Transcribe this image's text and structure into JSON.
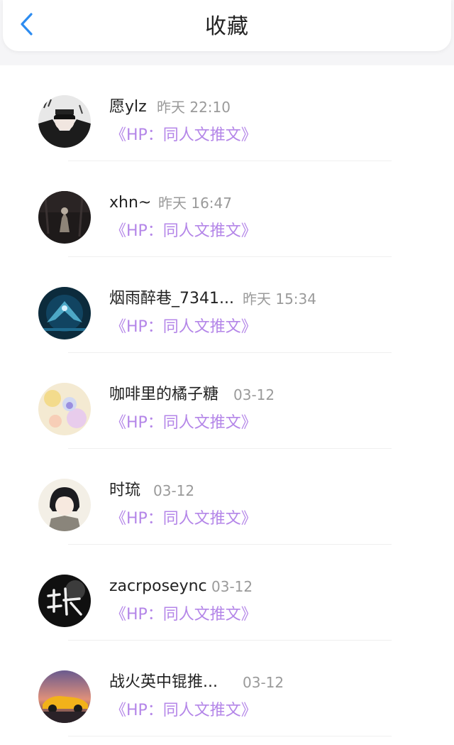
{
  "header": {
    "title": "收藏",
    "back_icon": "chevron-left-icon",
    "accent": "#2d8cf0"
  },
  "link_color": "#b486e8",
  "items": [
    {
      "name": "愿ylz",
      "time": "昨天 22:10",
      "book": "《HP：同人文推文》"
    },
    {
      "name": "xhn~",
      "time": "昨天 16:47",
      "book": "《HP：同人文推文》"
    },
    {
      "name": "烟雨醉巷_7341...",
      "time": "昨天 15:34",
      "book": "《HP：同人文推文》"
    },
    {
      "name": "咖啡里的橘子糖",
      "time": "03-12",
      "book": "《HP：同人文推文》"
    },
    {
      "name": "时琉",
      "time": "03-12",
      "book": "《HP：同人文推文》"
    },
    {
      "name": "zacrposeync",
      "time": "03-12",
      "book": "《HP：同人文推文》"
    },
    {
      "name": "战火英中锟推...",
      "time": "03-12",
      "book": "《HP：同人文推文》"
    }
  ]
}
